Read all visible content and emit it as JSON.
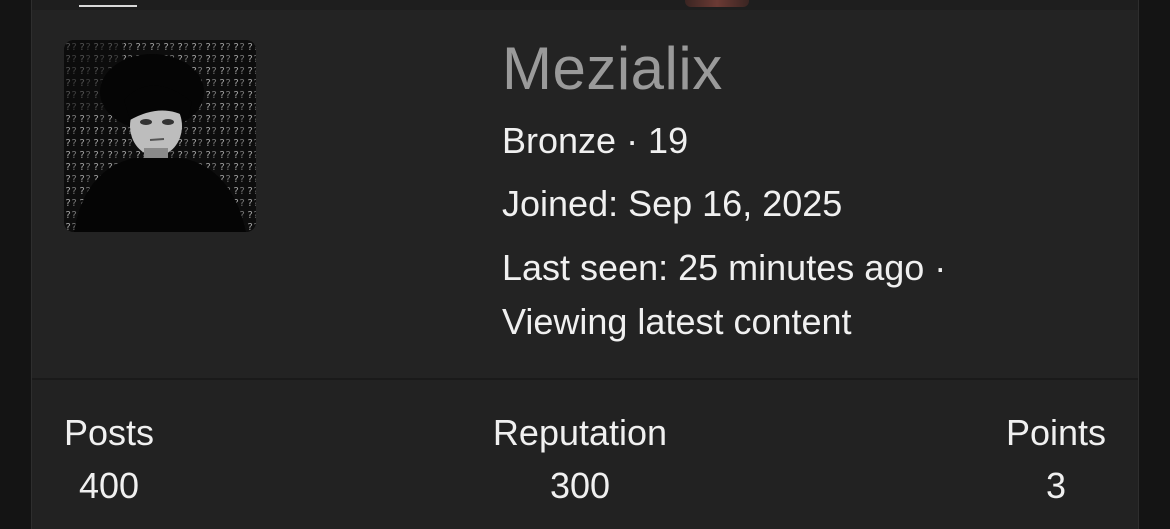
{
  "profile": {
    "username": "Mezialix",
    "rank": "Bronze · 19",
    "joined": "Joined: Sep 16, 2025",
    "last_seen": "Last seen: 25 minutes ago ·",
    "activity": "Viewing latest content",
    "avatar_icon": "user-avatar-image"
  },
  "stats": [
    {
      "label": "Posts",
      "value": "400"
    },
    {
      "label": "Reputation",
      "value": "300"
    },
    {
      "label": "Points",
      "value": "3"
    }
  ],
  "colors": {
    "background": "#141414",
    "card": "#232323",
    "username": "#9a9a9a",
    "text": "#f0f0f0"
  }
}
